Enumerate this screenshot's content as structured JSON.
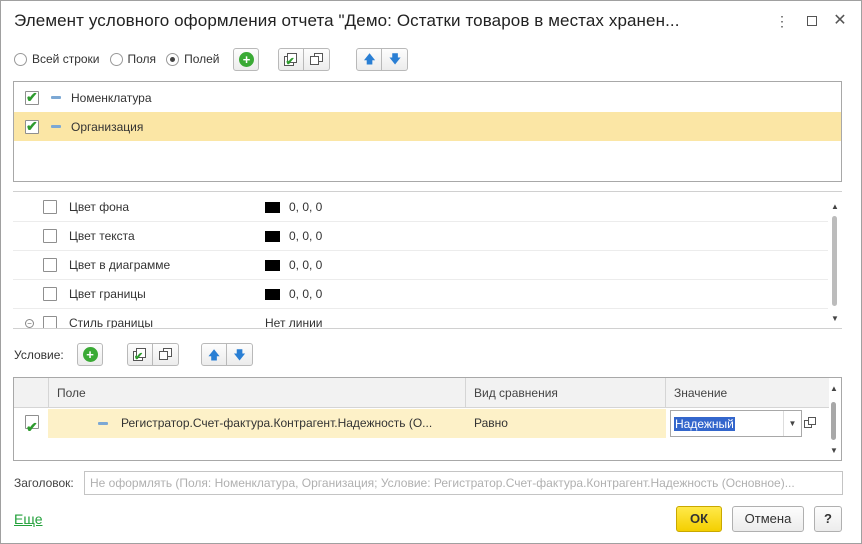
{
  "window": {
    "title": "Элемент условного оформления отчета \"Демо: Остатки товаров в местах хранен...",
    "more_icon": "more-vertical-icon",
    "maximize_icon": "maximize-icon",
    "close_icon": "close-icon"
  },
  "mode_radios": [
    {
      "label": "Всей строки",
      "selected": false
    },
    {
      "label": "Поля",
      "selected": false
    },
    {
      "label": "Полей",
      "selected": true
    }
  ],
  "fields": [
    {
      "label": "Номенклатура",
      "checked": true,
      "selected": false
    },
    {
      "label": "Организация",
      "checked": true,
      "selected": true
    }
  ],
  "appearance": [
    {
      "label": "Цвет фона",
      "value": "0, 0, 0",
      "swatch": "#000000"
    },
    {
      "label": "Цвет текста",
      "value": "0, 0, 0",
      "swatch": "#000000"
    },
    {
      "label": "Цвет в диаграмме",
      "value": "0, 0, 0",
      "swatch": "#000000"
    },
    {
      "label": "Цвет границы",
      "value": "0, 0, 0",
      "swatch": "#000000"
    },
    {
      "label": "Стиль границы",
      "value": "Нет линии"
    }
  ],
  "condition": {
    "label": "Условие:",
    "columns": [
      "Поле",
      "Вид сравнения",
      "Значение"
    ],
    "rows": [
      {
        "checked": true,
        "field": "Регистратор.Счет-фактура.Контрагент.Надежность (О...",
        "comparison": "Равно",
        "value": "Надежный"
      }
    ]
  },
  "header_field": {
    "label": "Заголовок:",
    "placeholder": "Не оформлять (Поля: Номенклатура, Организация; Условие: Регистратор.Счет-фактура.Контрагент.Надежность (Основное)..."
  },
  "footer": {
    "more_link": "Еще",
    "ok_label": "ОК",
    "cancel_label": "Отмена",
    "help_label": "?"
  },
  "colors": {
    "selection_row": "#fbe6a5",
    "ok_button": "#f4cf00",
    "checkmark": "#2e9b2e",
    "link": "#22a03a"
  }
}
